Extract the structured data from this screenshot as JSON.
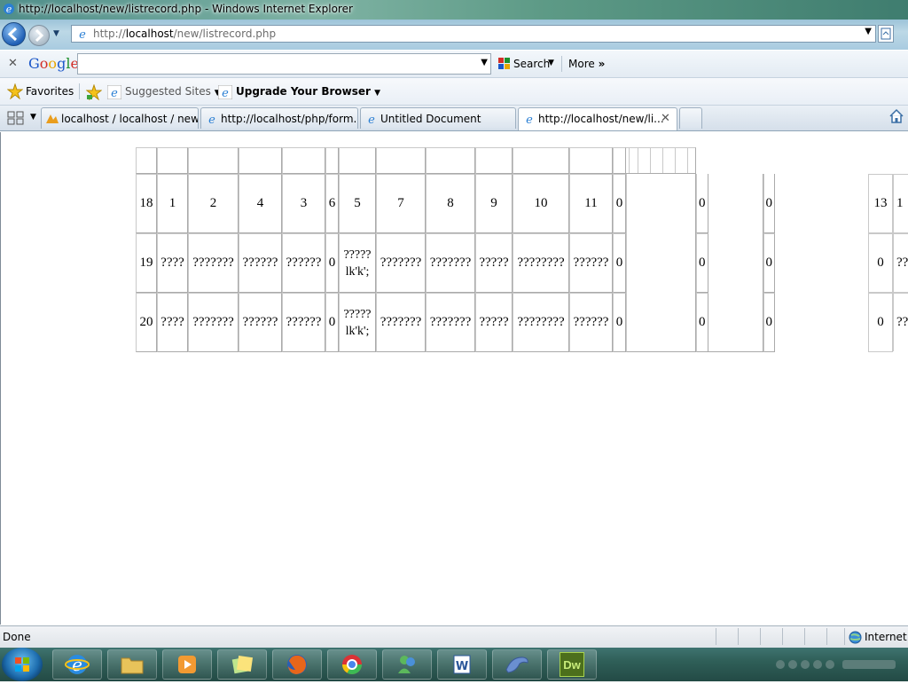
{
  "window": {
    "title": "http://localhost/new/listrecord.php - Windows Internet Explorer"
  },
  "address": {
    "prefix": "http://",
    "host": "localhost",
    "path": "/new/listrecord.php"
  },
  "google_toolbar": {
    "logo": "Google",
    "search_label": "Search",
    "more_label": "More",
    "search_value": ""
  },
  "favorites_bar": {
    "favorites_label": "Favorites",
    "suggested_label": "Suggested Sites",
    "upgrade_label": "Upgrade Your Browser"
  },
  "tabs": [
    {
      "label": "localhost / localhost / new..."
    },
    {
      "label": "http://localhost/php/form..."
    },
    {
      "label": "Untitled Document"
    },
    {
      "label": "http://localhost/new/li..."
    }
  ],
  "table": {
    "rows": [
      [
        "18",
        "1",
        "2",
        "4",
        "3",
        "6",
        "5",
        "7",
        "8",
        "9",
        "10",
        "11",
        "0",
        "0",
        "0",
        "13",
        "1"
      ],
      [
        "19",
        "????",
        "???????",
        "??????",
        "??????",
        "0",
        "????? lk'k';",
        "???????",
        "???????",
        "?????",
        "????????",
        "??????",
        "0",
        "0",
        "0",
        "0",
        "??"
      ],
      [
        "20",
        "????",
        "???????",
        "??????",
        "??????",
        "0",
        "????? lk'k';",
        "???????",
        "???????",
        "?????",
        "????????",
        "??????",
        "0",
        "0",
        "0",
        "0",
        "??"
      ]
    ]
  },
  "status_bar": {
    "status": "Done",
    "zone": "Internet |"
  },
  "taskbar": {
    "apps": [
      "Internet Explorer",
      "Windows Explorer",
      "Media Player",
      "Sticky Notes",
      "Firefox",
      "Chrome",
      "Messenger",
      "Word",
      "Dolphin",
      "Dreamweaver"
    ],
    "dreamweaver_label": "Dw"
  },
  "colors": {
    "titlebar": "#5d9a86",
    "taskbar": "#2f5f58",
    "table_border": "#c9c9c9",
    "link_blue": "#1f5fb5"
  }
}
